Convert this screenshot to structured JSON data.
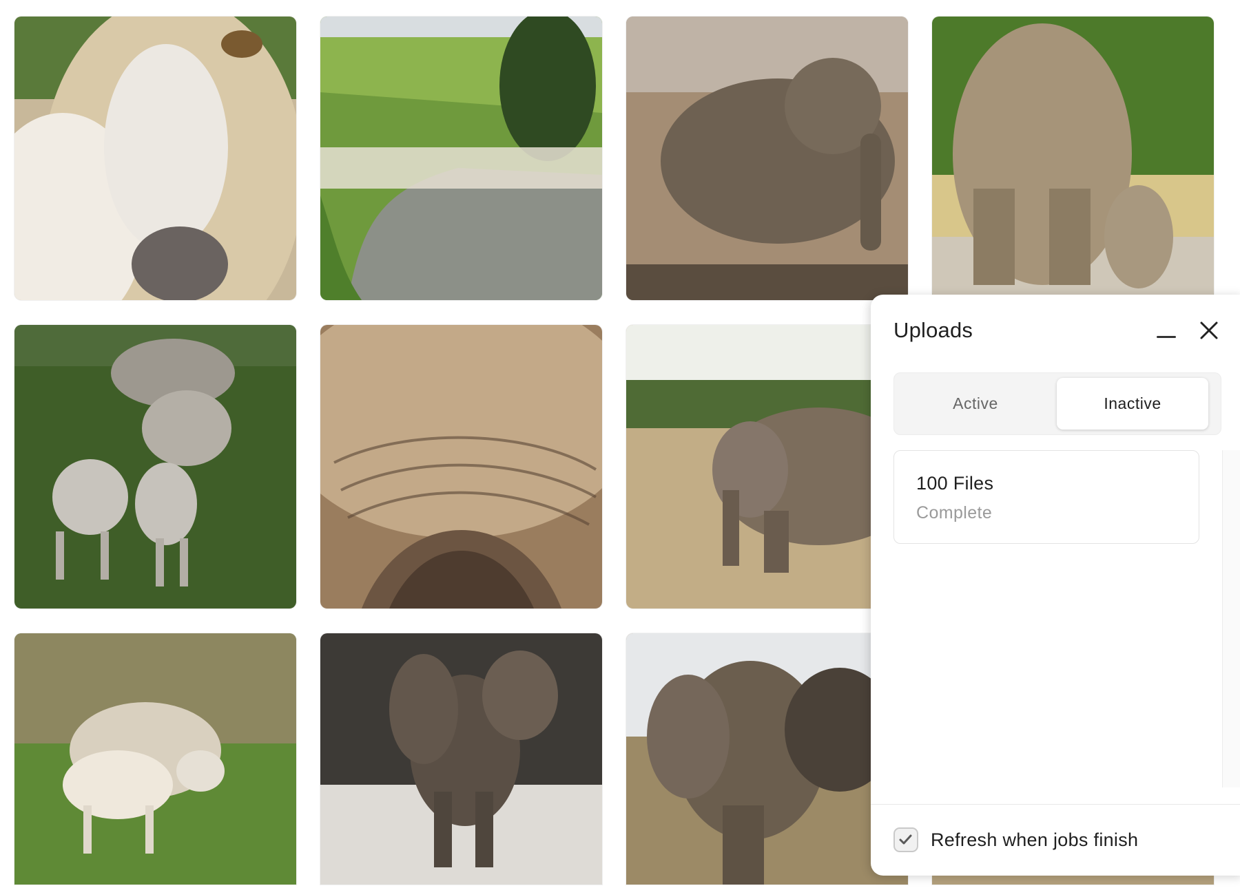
{
  "gallery": {
    "images": [
      {
        "subject": "goat face close-up"
      },
      {
        "subject": "flock of sheep on road"
      },
      {
        "subject": "elephant at waterhole"
      },
      {
        "subject": "elephant and calf from behind"
      },
      {
        "subject": "ewe with lambs in field"
      },
      {
        "subject": "elephant skin close-up"
      },
      {
        "subject": "elephant in savanna"
      },
      {
        "subject": "ewe and lamb grazing"
      },
      {
        "subject": "baby elephant"
      },
      {
        "subject": "elephant in grassland"
      },
      {
        "subject": "partially hidden image"
      }
    ]
  },
  "uploads_panel": {
    "title": "Uploads",
    "minimize_icon": "minimize-icon",
    "close_icon": "close-icon",
    "tabs": [
      {
        "label": "Active",
        "selected": false
      },
      {
        "label": "Inactive",
        "selected": true
      }
    ],
    "jobs": [
      {
        "files": "100 Files",
        "status": "Complete"
      }
    ],
    "footer": {
      "checkbox_label": "Refresh when jobs finish",
      "checked": true
    }
  }
}
